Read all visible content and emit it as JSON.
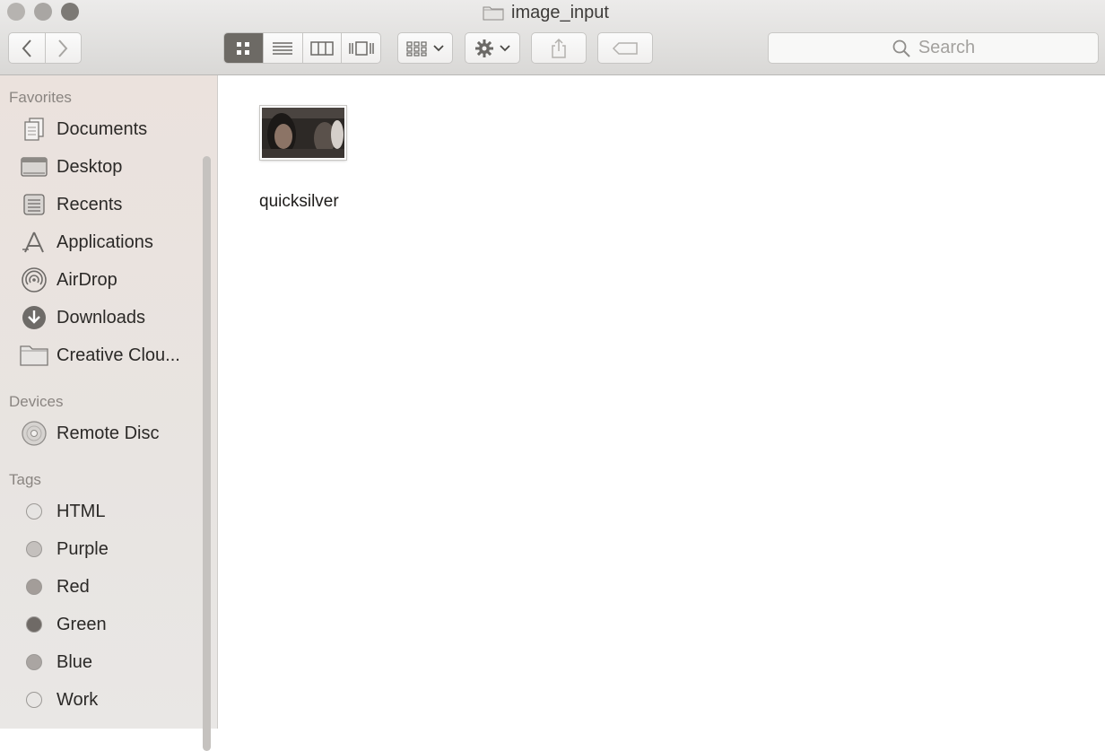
{
  "window": {
    "title": "image_input"
  },
  "toolbar": {
    "back_icon": "chevron-left-icon",
    "forward_icon": "chevron-right-icon",
    "views": [
      "icon-view",
      "list-view",
      "column-view",
      "cover-flow-view"
    ],
    "active_view": "icon-view",
    "search_placeholder": "Search"
  },
  "sidebar": {
    "favorites_heading": "Favorites",
    "favorites": [
      {
        "label": "Documents",
        "icon": "documents-icon"
      },
      {
        "label": "Desktop",
        "icon": "desktop-icon"
      },
      {
        "label": "Recents",
        "icon": "recents-icon"
      },
      {
        "label": "Applications",
        "icon": "applications-icon"
      },
      {
        "label": "AirDrop",
        "icon": "airdrop-icon"
      },
      {
        "label": "Downloads",
        "icon": "downloads-icon"
      },
      {
        "label": "Creative Clou...",
        "icon": "folder-icon"
      }
    ],
    "devices_heading": "Devices",
    "devices": [
      {
        "label": "Remote Disc",
        "icon": "disc-icon"
      }
    ],
    "tags_heading": "Tags",
    "tags": [
      {
        "label": "HTML",
        "color": "#e6e4e2"
      },
      {
        "label": "Purple",
        "color": "#c4c0bd"
      },
      {
        "label": "Red",
        "color": "#a39d99"
      },
      {
        "label": "Green",
        "color": "#6f6a66"
      },
      {
        "label": "Blue",
        "color": "#aaa5a2"
      },
      {
        "label": "Work",
        "color": "#e8e6e4"
      }
    ]
  },
  "content": {
    "files": [
      {
        "name": "quicksilver",
        "kind": "image-thumbnail"
      }
    ]
  }
}
